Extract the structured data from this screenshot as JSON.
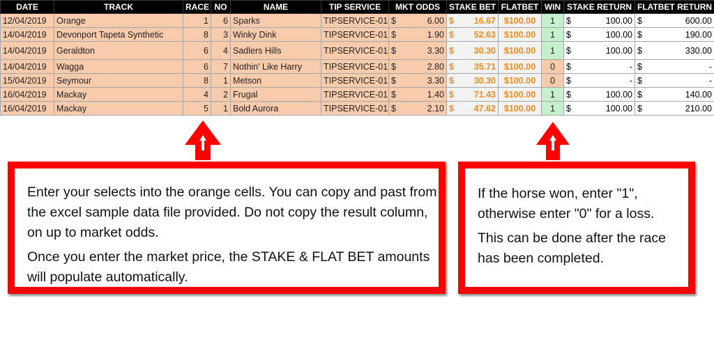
{
  "table": {
    "headers": [
      "DATE",
      "TRACK",
      "RACE",
      "NO",
      "NAME",
      "TIP SERVICE",
      "MKT ODDS",
      "STAKE BET",
      "FLATBET",
      "WIN",
      "STAKE RETURN",
      "FLATBET RETURN"
    ],
    "rows": [
      {
        "date": "12/04/2019",
        "track": "Orange",
        "race": "1",
        "no": "6",
        "name": "Sparks",
        "tip": "TIPSERVICE-01",
        "odds_cur": "$",
        "odds": "6.00",
        "stake_cur": "$",
        "stake": "16.67",
        "flatbet": "$100.00",
        "win": "1",
        "sr_cur": "$",
        "stake_return": "100.00",
        "fr_cur": "$",
        "flatbet_return": "600.00"
      },
      {
        "date": "14/04/2019",
        "track": "Devonport Tapeta Synthetic",
        "race": "8",
        "no": "3",
        "name": "Winky Dink",
        "tip": "TIPSERVICE-01",
        "odds_cur": "$",
        "odds": "1.90",
        "stake_cur": "$",
        "stake": "52.63",
        "flatbet": "$100.00",
        "win": "1",
        "sr_cur": "$",
        "stake_return": "100.00",
        "fr_cur": "$",
        "flatbet_return": "190.00"
      },
      {
        "date": "14/04/2019",
        "track": "Geraldton",
        "race": "6",
        "no": "4",
        "name": "Sadlers Hills",
        "tip": "TIPSERVICE-01",
        "odds_cur": "$",
        "odds": "3.30",
        "stake_cur": "$",
        "stake": "30.30",
        "flatbet": "$100.00",
        "win": "1",
        "sr_cur": "$",
        "stake_return": "100.00",
        "fr_cur": "$",
        "flatbet_return": "330.00"
      },
      {
        "date": "14/04/2019",
        "track": "Wagga",
        "race": "6",
        "no": "7",
        "name": "Nothin' Like Harry",
        "tip": "TIPSERVICE-01",
        "odds_cur": "$",
        "odds": "2.80",
        "stake_cur": "$",
        "stake": "35.71",
        "flatbet": "$100.00",
        "win": "0",
        "sr_cur": "$",
        "stake_return": "-",
        "fr_cur": "$",
        "flatbet_return": "-"
      },
      {
        "date": "15/04/2019",
        "track": "Seymour",
        "race": "8",
        "no": "1",
        "name": "Metson",
        "tip": "TIPSERVICE-01",
        "odds_cur": "$",
        "odds": "3.30",
        "stake_cur": "$",
        "stake": "30.30",
        "flatbet": "$100.00",
        "win": "0",
        "sr_cur": "$",
        "stake_return": "-",
        "fr_cur": "$",
        "flatbet_return": "-"
      },
      {
        "date": "16/04/2019",
        "track": "Mackay",
        "race": "4",
        "no": "2",
        "name": "Frugal",
        "tip": "TIPSERVICE-01",
        "odds_cur": "$",
        "odds": "1.40",
        "stake_cur": "$",
        "stake": "71.43",
        "flatbet": "$100.00",
        "win": "1",
        "sr_cur": "$",
        "stake_return": "100.00",
        "fr_cur": "$",
        "flatbet_return": "140.00"
      },
      {
        "date": "16/04/2019",
        "track": "Mackay",
        "race": "5",
        "no": "1",
        "name": "Bold Aurora",
        "tip": "TIPSERVICE-01",
        "odds_cur": "$",
        "odds": "2.10",
        "stake_cur": "$",
        "stake": "47.62",
        "flatbet": "$100.00",
        "win": "1",
        "sr_cur": "$",
        "stake_return": "100.00",
        "fr_cur": "$",
        "flatbet_return": "210.00"
      }
    ]
  },
  "callouts": {
    "left": {
      "line1": "Enter your selects into the orange cells. You can copy and past from the excel sample data file provided. Do not copy the result column, on up to market odds.",
      "line2": "Once you enter the market price, the STAKE & FLAT BET amounts will populate automatically."
    },
    "right": {
      "line1": "If the horse won, enter \"1\", otherwise enter \"0\" for a loss.",
      "line2": "This can be done after the race has been completed."
    }
  },
  "colors": {
    "input_cell": "#f8cbad",
    "win_cell": "#c6efce",
    "calc_text": "#f28a1e",
    "callout_border": "#ff0000",
    "header_bg": "#000000"
  }
}
